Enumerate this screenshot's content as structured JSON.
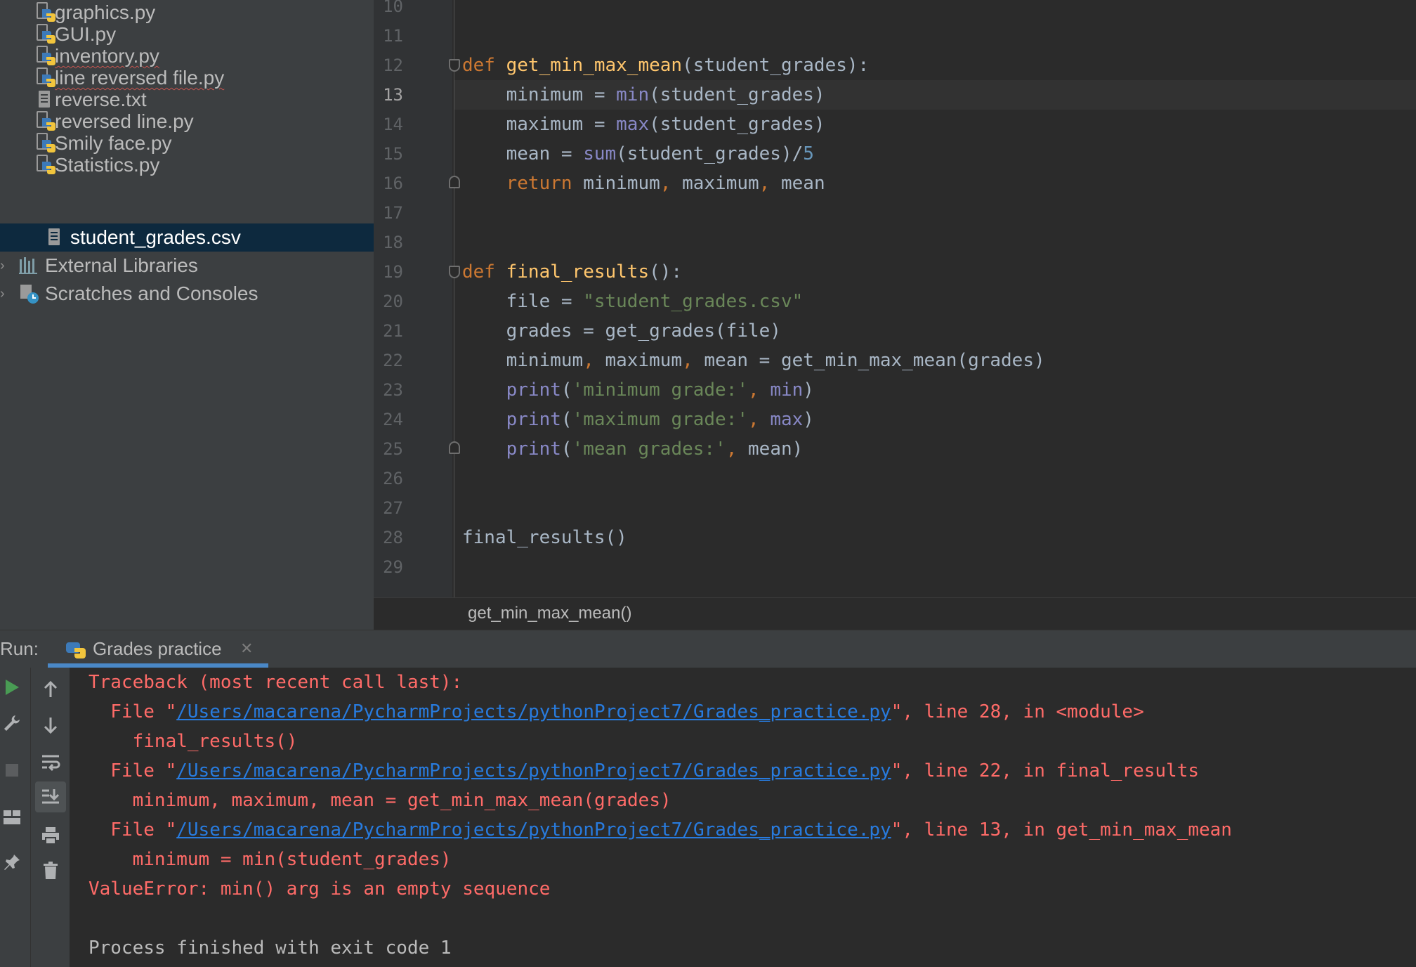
{
  "project_tree": {
    "files": [
      {
        "name": "graphics.py",
        "icon": "python-file-icon",
        "squiggle": false
      },
      {
        "name": "GUI.py",
        "icon": "python-file-icon",
        "squiggle": false
      },
      {
        "name": "inventory.py",
        "icon": "python-file-icon",
        "squiggle": true
      },
      {
        "name": "line reversed file.py",
        "icon": "python-file-icon",
        "squiggle": true
      },
      {
        "name": "reverse.txt",
        "icon": "text-file-icon",
        "squiggle": false
      },
      {
        "name": "reversed line.py",
        "icon": "python-file-icon",
        "squiggle": false
      },
      {
        "name": "Smily face.py",
        "icon": "python-file-icon",
        "squiggle": false
      },
      {
        "name": "Statistics.py",
        "icon": "python-file-icon",
        "squiggle": false
      },
      {
        "name": "student_grades.csv",
        "icon": "text-file-icon",
        "squiggle": false,
        "selected": true
      }
    ],
    "external_libraries": "External Libraries",
    "scratches": "Scratches and Consoles"
  },
  "editor": {
    "current_line": "13",
    "lines": [
      {
        "no": "10",
        "text": ""
      },
      {
        "no": "11",
        "text": ""
      },
      {
        "no": "12",
        "text": "def get_min_max_mean(student_grades):"
      },
      {
        "no": "13",
        "text": "    minimum = min(student_grades)"
      },
      {
        "no": "14",
        "text": "    maximum = max(student_grades)"
      },
      {
        "no": "15",
        "text": "    mean = sum(student_grades)/5"
      },
      {
        "no": "16",
        "text": "    return minimum, maximum, mean"
      },
      {
        "no": "17",
        "text": ""
      },
      {
        "no": "18",
        "text": ""
      },
      {
        "no": "19",
        "text": "def final_results():"
      },
      {
        "no": "20",
        "text": "    file = \"student_grades.csv\""
      },
      {
        "no": "21",
        "text": "    grades = get_grades(file)"
      },
      {
        "no": "22",
        "text": "    minimum, maximum, mean = get_min_max_mean(grades)"
      },
      {
        "no": "23",
        "text": "    print('minimum grade:', min)"
      },
      {
        "no": "24",
        "text": "    print('maximum grade:', max)"
      },
      {
        "no": "25",
        "text": "    print('mean grades:', mean)"
      },
      {
        "no": "26",
        "text": ""
      },
      {
        "no": "27",
        "text": ""
      },
      {
        "no": "28",
        "text": "final_results()"
      },
      {
        "no": "29",
        "text": ""
      }
    ],
    "breadcrumb": "get_min_max_mean()"
  },
  "run_panel": {
    "label": "Run:",
    "tab_label": "Grades practice",
    "toolbar_icons": [
      "run-icon",
      "wrench-icon",
      "stop-icon",
      "layout-icon",
      "pin-icon",
      "up-arrow-icon",
      "down-arrow-icon",
      "soft-wrap-icon",
      "scroll-to-end-icon",
      "print-icon",
      "trash-icon"
    ],
    "console": {
      "traceback_header": "Traceback (most recent call last):",
      "frames": [
        {
          "prefix": "  File \"",
          "path": "/Users/macarena/PycharmProjects/pythonProject7/Grades_practice.py",
          "suffix": "\", line 28, in <module>",
          "code": "    final_results()"
        },
        {
          "prefix": "  File \"",
          "path": "/Users/macarena/PycharmProjects/pythonProject7/Grades_practice.py",
          "suffix": "\", line 22, in final_results",
          "code": "    minimum, maximum, mean = get_min_max_mean(grades)"
        },
        {
          "prefix": "  File \"",
          "path": "/Users/macarena/PycharmProjects/pythonProject7/Grades_practice.py",
          "suffix": "\", line 13, in get_min_max_mean",
          "code": "    minimum = min(student_grades)"
        }
      ],
      "error": "ValueError: min() arg is an empty sequence",
      "exit_message": "Process finished with exit code 1"
    }
  },
  "colors": {
    "keyword": "#cc7832",
    "function_name": "#ffc66d",
    "builtin": "#8888c6",
    "string": "#6a8759",
    "number": "#6897bb",
    "error_text": "#ff6b68",
    "link": "#287bde",
    "selection": "#0d293e"
  }
}
